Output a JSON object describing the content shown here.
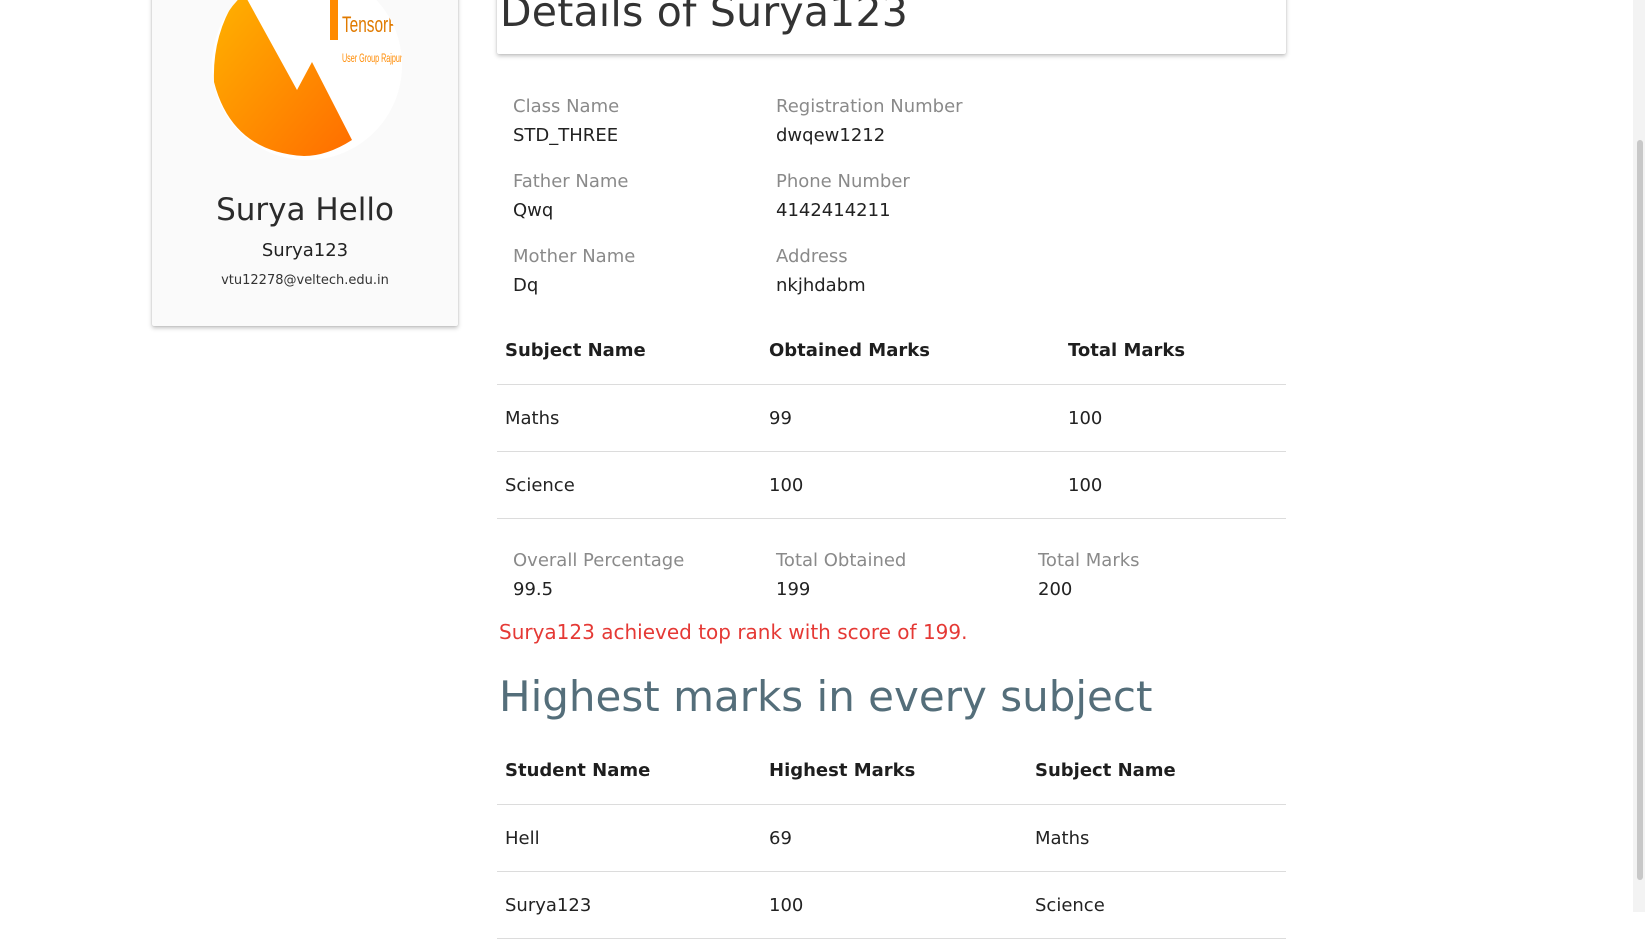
{
  "profile": {
    "name": "Surya Hello",
    "username": "Surya123",
    "email": "vtu12278@veltech.edu.in",
    "logo_text_main": "TensorFlow",
    "logo_text_sub": "User Group Rajpur"
  },
  "header": {
    "title": "Details of Surya123"
  },
  "details": [
    {
      "label": "Class Name",
      "value": "STD_THREE"
    },
    {
      "label": "Registration Number",
      "value": "dwqew1212"
    },
    {
      "label": "Father Name",
      "value": "Qwq"
    },
    {
      "label": "Phone Number",
      "value": "4142414211"
    },
    {
      "label": "Mother Name",
      "value": "Dq"
    },
    {
      "label": "Address",
      "value": "nkjhdabm"
    }
  ],
  "marks_table": {
    "headers": [
      "Subject Name",
      "Obtained Marks",
      "Total Marks"
    ],
    "rows": [
      [
        "Maths",
        "99",
        "100"
      ],
      [
        "Science",
        "100",
        "100"
      ]
    ]
  },
  "summary": [
    {
      "label": "Overall Percentage",
      "value": "99.5"
    },
    {
      "label": "Total Obtained",
      "value": "199"
    },
    {
      "label": "Total Marks",
      "value": "200"
    }
  ],
  "rank_message": "Surya123 achieved top rank with score of 199.",
  "highest_section": {
    "title": "Highest marks in every subject",
    "headers": [
      "Student Name",
      "Highest Marks",
      "Subject Name"
    ],
    "rows": [
      [
        "Hell",
        "69",
        "Maths"
      ],
      [
        "Surya123",
        "100",
        "Science"
      ]
    ]
  },
  "colors": {
    "rank_message": "#e53935",
    "section_title": "#546e7a",
    "logo_orange": "#ff8a00"
  }
}
